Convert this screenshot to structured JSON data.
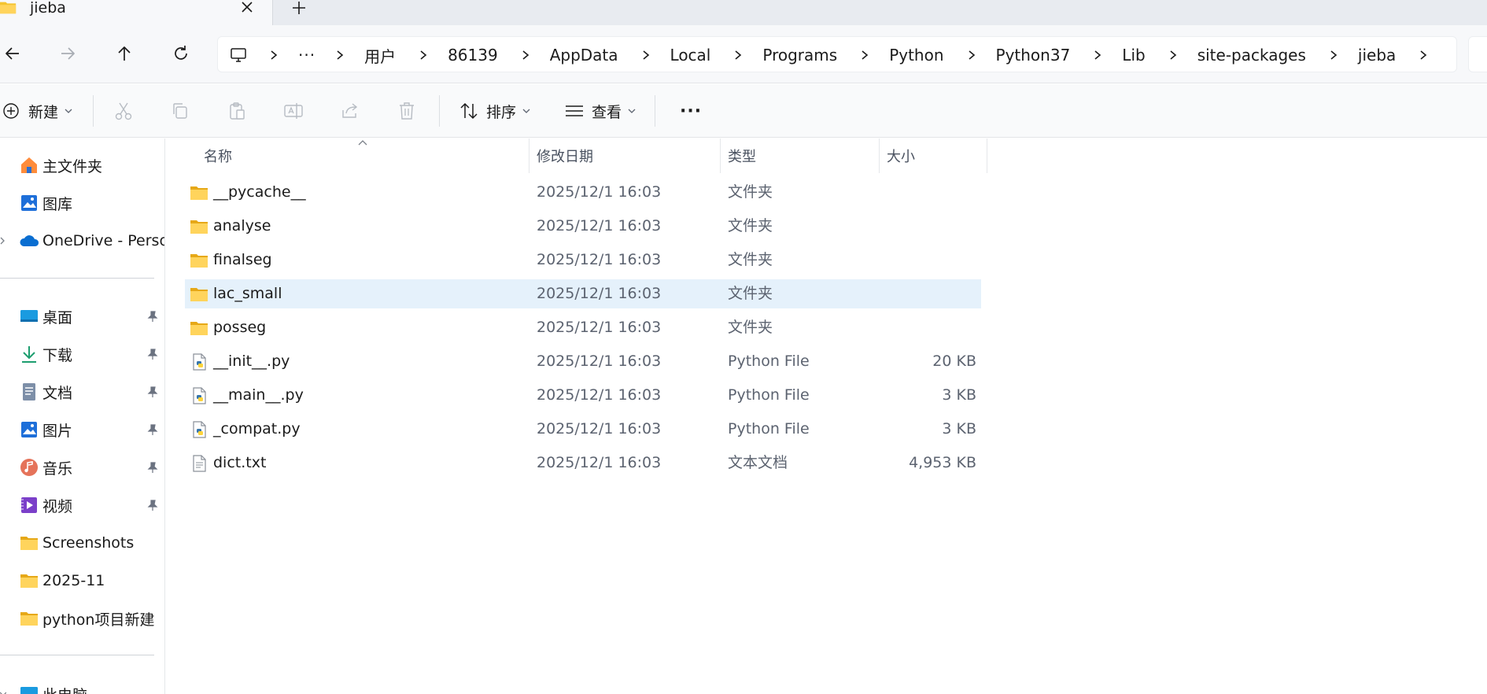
{
  "tab": {
    "title": "jieba",
    "close_icon": "close-icon",
    "new_tab_icon": "plus-icon"
  },
  "nav": {
    "back_icon": "arrow-left-icon",
    "forward_icon": "arrow-right-icon",
    "up_icon": "arrow-up-icon",
    "refresh_icon": "refresh-icon"
  },
  "breadcrumb": {
    "overflow": "···",
    "items": [
      "用户",
      "86139",
      "AppData",
      "Local",
      "Programs",
      "Python",
      "Python37",
      "Lib",
      "site-packages",
      "jieba"
    ]
  },
  "commands": {
    "new_label": "新建",
    "sort_label": "排序",
    "view_label": "查看",
    "more_label": "···"
  },
  "sidebar": {
    "top": [
      {
        "label": "主文件夹",
        "icon": "home-icon"
      },
      {
        "label": "图库",
        "icon": "gallery-icon"
      },
      {
        "label": "OneDrive - Persor",
        "icon": "onedrive-cloud-icon"
      }
    ],
    "quick": [
      {
        "label": "桌面",
        "icon": "desktop-icon",
        "pinned": true
      },
      {
        "label": "下载",
        "icon": "download-icon",
        "pinned": true
      },
      {
        "label": "文档",
        "icon": "documents-icon",
        "pinned": true
      },
      {
        "label": "图片",
        "icon": "pictures-icon",
        "pinned": true
      },
      {
        "label": "音乐",
        "icon": "music-icon",
        "pinned": true
      },
      {
        "label": "视频",
        "icon": "videos-icon",
        "pinned": true
      },
      {
        "label": "Screenshots",
        "icon": "folder-icon",
        "pinned": false
      },
      {
        "label": "2025-11",
        "icon": "folder-icon",
        "pinned": false
      },
      {
        "label": "python项目新建",
        "icon": "folder-icon",
        "pinned": false
      }
    ],
    "bottom": [
      {
        "label": "此电脑",
        "icon": "this-pc-icon"
      }
    ]
  },
  "columns": {
    "name": "名称",
    "modified": "修改日期",
    "type": "类型",
    "size": "大小"
  },
  "files": [
    {
      "name": "__pycache__",
      "modified": "2025/12/1 16:03",
      "type": "文件夹",
      "size": "",
      "icon": "folder-icon"
    },
    {
      "name": "analyse",
      "modified": "2025/12/1 16:03",
      "type": "文件夹",
      "size": "",
      "icon": "folder-icon"
    },
    {
      "name": "finalseg",
      "modified": "2025/12/1 16:03",
      "type": "文件夹",
      "size": "",
      "icon": "folder-icon"
    },
    {
      "name": "lac_small",
      "modified": "2025/12/1 16:03",
      "type": "文件夹",
      "size": "",
      "icon": "folder-icon",
      "selected": true
    },
    {
      "name": "posseg",
      "modified": "2025/12/1 16:03",
      "type": "文件夹",
      "size": "",
      "icon": "folder-icon"
    },
    {
      "name": "__init__.py",
      "modified": "2025/12/1 16:03",
      "type": "Python File",
      "size": "20 KB",
      "icon": "python-file-icon"
    },
    {
      "name": "__main__.py",
      "modified": "2025/12/1 16:03",
      "type": "Python File",
      "size": "3 KB",
      "icon": "python-file-icon"
    },
    {
      "name": "_compat.py",
      "modified": "2025/12/1 16:03",
      "type": "Python File",
      "size": "3 KB",
      "icon": "python-file-icon"
    },
    {
      "name": "dict.txt",
      "modified": "2025/12/1 16:03",
      "type": "文本文档",
      "size": "4,953 KB",
      "icon": "text-file-icon"
    }
  ],
  "colors": {
    "selection": "#e5f1fb",
    "folder": "#f4c430",
    "accent": "#0067c0"
  }
}
